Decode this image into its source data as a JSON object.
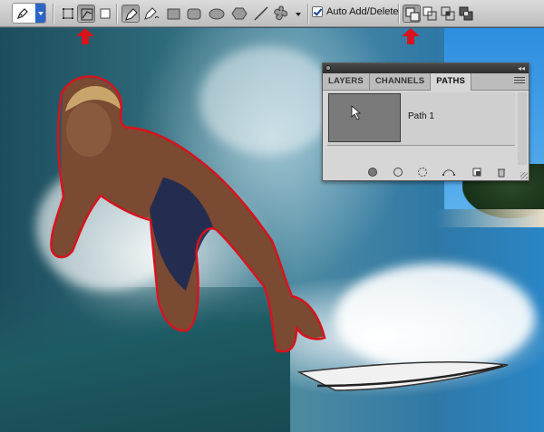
{
  "toolbar": {
    "auto_add_delete_label": "Auto Add/Delete",
    "auto_add_delete_checked": true
  },
  "panel": {
    "tabs": [
      {
        "label": "LAYERS",
        "active": false
      },
      {
        "label": "CHANNELS",
        "active": false
      },
      {
        "label": "PATHS",
        "active": true
      }
    ],
    "path_items": [
      {
        "name": "Path 1"
      }
    ]
  },
  "colors": {
    "path_stroke": "#d5141e",
    "arrow": "#d5141e",
    "accent_blue": "#2b63c9"
  }
}
